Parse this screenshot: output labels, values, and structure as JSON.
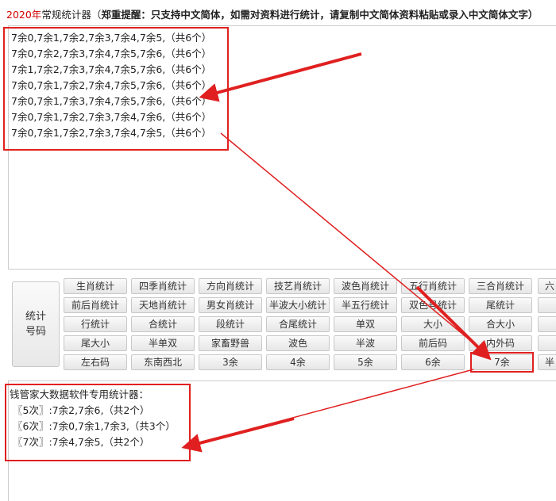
{
  "header": {
    "year": "2020年",
    "label": "常规统计器（",
    "warning": "郑重提醒：只支持中文简体，如需对资料进行统计，请复制中文简体资料粘贴或录入中文简体文字）"
  },
  "input_lines": [
    "7余0,7余1,7余2,7余3,7余4,7余5,（共6个）",
    "7余0,7余2,7余3,7余4,7余5,7余6,（共6个）",
    "7余1,7余2,7余3,7余4,7余5,7余6,（共6个）",
    "7余0,7余1,7余2,7余4,7余5,7余6,（共6个）",
    "7余0,7余1,7余3,7余4,7余5,7余6,（共6个）",
    "7余0,7余1,7余2,7余3,7余4,7余6,（共6个）",
    "7余0,7余1,7余2,7余3,7余4,7余5,（共6个）"
  ],
  "side_button": {
    "line1": "统计",
    "line2": "号码"
  },
  "buttons": [
    [
      "生肖统计",
      "四季肖统计",
      "方向肖统计",
      "技艺肖统计",
      "波色肖统计",
      "五行肖统计",
      "三合肖统计",
      "六"
    ],
    [
      "前后肖统计",
      "天地肖统计",
      "男女肖统计",
      "半波大小统计",
      "半五行统计",
      "双色号统计",
      "尾统计",
      ""
    ],
    [
      "行统计",
      "合统计",
      "段统计",
      "合尾统计",
      "单双",
      "大小",
      "合大小",
      ""
    ],
    [
      "尾大小",
      "半单双",
      "家畜野兽",
      "波色",
      "半波",
      "前后码",
      "内外码",
      ""
    ],
    [
      "左右码",
      "东南西北",
      "3余",
      "4余",
      "5余",
      "6余",
      "7余",
      "半"
    ]
  ],
  "results": {
    "heading": "钱管家大数据软件专用统计器：",
    "lines": [
      "〖5次〗:7余2,7余6,（共2个）",
      "〖6次〗:7余0,7余1,7余3,（共3个）",
      "〖7次〗:7余4,7余5,（共2个）"
    ]
  },
  "annotation_color": "#e02020"
}
